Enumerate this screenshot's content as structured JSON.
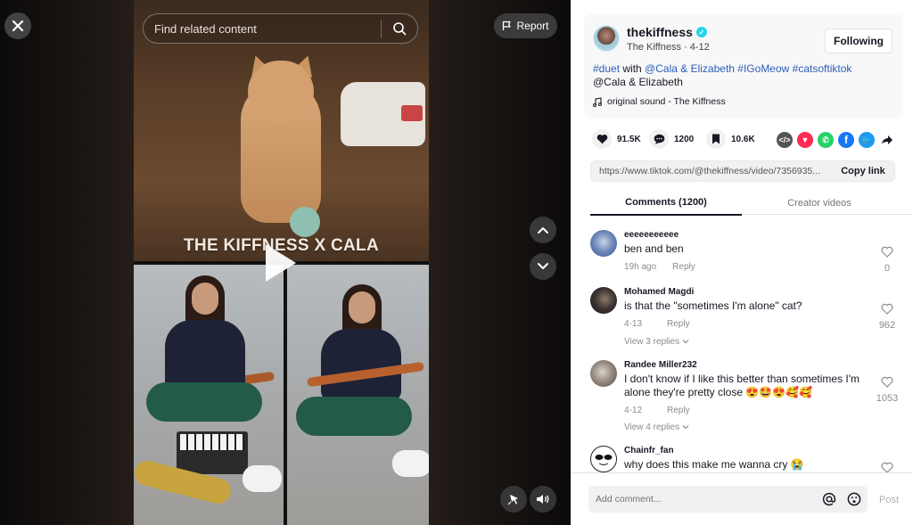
{
  "video": {
    "search_placeholder": "Find related content",
    "report_label": "Report",
    "overlay_title": "THE KIFFNESS X CALA",
    "icons": {
      "close": "close-icon",
      "search": "search-icon",
      "report": "flag-icon",
      "play": "play-icon",
      "prev": "chevron-up-icon",
      "next": "chevron-down-icon",
      "floating": "floating-player-icon",
      "volume": "volume-icon"
    }
  },
  "post": {
    "author": "thekiffness",
    "verified": true,
    "author_display": "The Kiffness",
    "date": "4-12",
    "follow_label": "Following",
    "description": {
      "hashtag_duet": "#duet",
      "with_text": " with ",
      "mention": "@Cala & Elizabeth",
      "hashtag_1": "#IGoMeow",
      "hashtag_2": "#catsoftiktok",
      "second_line": "@Cala & Elizabeth"
    },
    "sound": "original sound - The Kiffness"
  },
  "stats": {
    "likes": "91.5K",
    "comments": "1200",
    "saves": "10.6K"
  },
  "share": {
    "targets": [
      "embed",
      "send-to-friends",
      "whatsapp",
      "facebook",
      "twitter",
      "more"
    ],
    "colors": {
      "embed": "#555555",
      "send": "#fe2c55",
      "whatsapp": "#25d366",
      "facebook": "#1877f2",
      "twitter": "#1d9bf0"
    },
    "link": "https://www.tiktok.com/@thekiffness/video/7356935...",
    "copy_label": "Copy link"
  },
  "tabs": [
    {
      "label": "Comments (1200)",
      "active": true
    },
    {
      "label": "Creator videos",
      "active": false
    }
  ],
  "comments": [
    {
      "user": "eeeeeeeeeee",
      "text": "ben and ben",
      "time": "19h ago",
      "reply_label": "Reply",
      "likes": "0",
      "replies": null
    },
    {
      "user": "Mohamed Magdi",
      "text": "is that the \"sometimes I'm alone\" cat?",
      "time": "4-13",
      "reply_label": "Reply",
      "likes": "962",
      "replies": "View 3 replies"
    },
    {
      "user": "Randee Miller232",
      "text": "I don't know if I like this better than sometimes I'm alone they're pretty close 😍🤩😍🥰🥰",
      "time": "4-12",
      "reply_label": "Reply",
      "likes": "1053",
      "replies": "View 4 replies"
    },
    {
      "user": "Chainfr_fan",
      "text": "why does this make me wanna cry 😭",
      "time": "",
      "reply_label": "",
      "likes": "",
      "replies": null
    }
  ],
  "composer": {
    "placeholder": "Add comment...",
    "post_label": "Post"
  }
}
